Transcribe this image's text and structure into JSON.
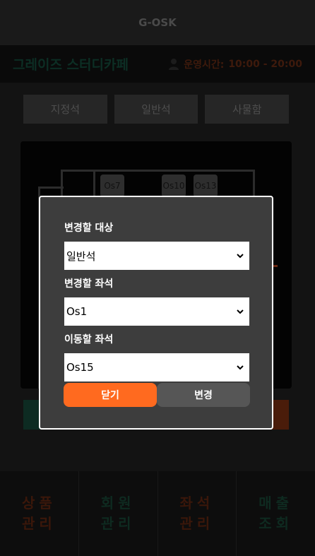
{
  "app": {
    "title": "G-OSK"
  },
  "header": {
    "shop_name": "그레이즈 스터디카페",
    "hours_label": "운영시간:",
    "hours_value": "10:00 - 20:00",
    "icon": "user-icon"
  },
  "tabs": [
    {
      "label": "지정석"
    },
    {
      "label": "일반석"
    },
    {
      "label": "사물함"
    }
  ],
  "map": {
    "seats": [
      {
        "label": "Os7"
      },
      {
        "label": "Os10"
      },
      {
        "label": "Os13"
      }
    ]
  },
  "bottom_nav": [
    {
      "line1": "상품",
      "line2": "관리"
    },
    {
      "line1": "회원",
      "line2": "관리"
    },
    {
      "line1": "좌석",
      "line2": "관리"
    },
    {
      "line1": "매출",
      "line2": "조회"
    }
  ],
  "modal": {
    "target_label": "변경할 대상",
    "target_value": "일반석",
    "seat_label": "변경할 좌석",
    "seat_value": "Os1",
    "dest_label": "이동할 좌석",
    "dest_value": "Os15",
    "close_label": "닫기",
    "change_label": "변경"
  },
  "colors": {
    "accent_orange": "#ff6a1f",
    "modal_bg": "#3d3d3d",
    "button_gray": "#565656"
  }
}
